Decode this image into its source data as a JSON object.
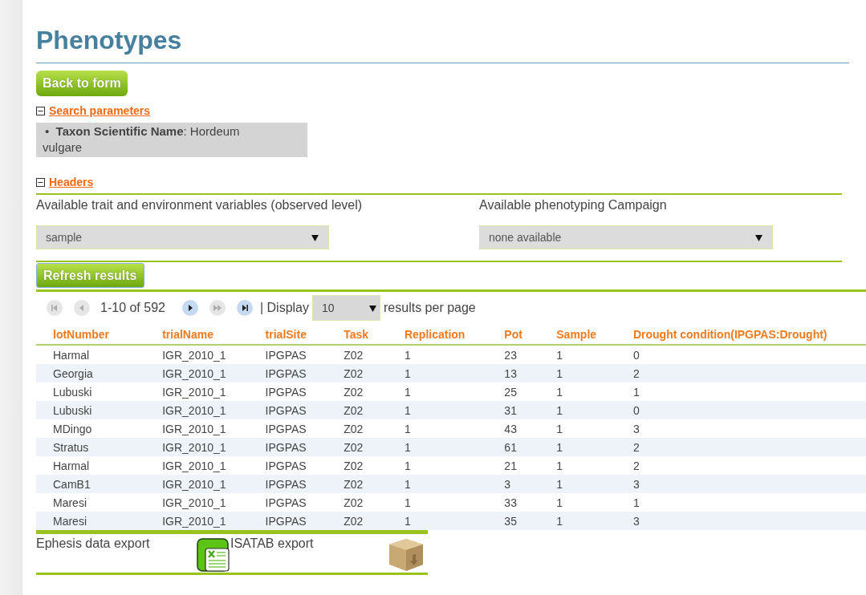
{
  "title": "Phenotypes",
  "back_button": "Back to form",
  "search_parameters": {
    "label": "Search parameters",
    "expanded": true,
    "items": [
      "•  **Taxon Scientific Name**: Hordeum vulgare"
    ]
  },
  "headers": {
    "label": "Headers",
    "expanded": true,
    "selects": [
      {
        "label": "Available trait and environment variables (observed level)",
        "value": "sample"
      },
      {
        "label": "Available phenotyping Campaign",
        "value": "none available"
      }
    ]
  },
  "refresh_button": "Refresh results",
  "pager": {
    "buttons": [
      {
        "kind": "first",
        "disabled": true
      },
      {
        "kind": "prev",
        "disabled": true
      },
      {
        "kind": "range",
        "text": "1-10 of 592"
      },
      {
        "kind": "next",
        "disabled": false
      },
      {
        "kind": "fast",
        "disabled": true
      },
      {
        "kind": "last",
        "disabled": false
      }
    ],
    "display_label": "| Display",
    "page_size": "10",
    "suffix": "results per page"
  },
  "table": {
    "columns": [
      "lotNumber",
      "trialName",
      "trialSite",
      "Task",
      "Replication",
      "Pot",
      "Sample",
      "Drought condition(IPGPAS:Drought)"
    ],
    "rows": [
      [
        "Harmal",
        "IGR_2010_1",
        "IPGPAS",
        "Z02",
        "1",
        "23",
        "1",
        "0"
      ],
      [
        "Georgia",
        "IGR_2010_1",
        "IPGPAS",
        "Z02",
        "1",
        "13",
        "1",
        "2"
      ],
      [
        "Lubuski",
        "IGR_2010_1",
        "IPGPAS",
        "Z02",
        "1",
        "25",
        "1",
        "1"
      ],
      [
        "Lubuski",
        "IGR_2010_1",
        "IPGPAS",
        "Z02",
        "1",
        "31",
        "1",
        "0"
      ],
      [
        "MDingo",
        "IGR_2010_1",
        "IPGPAS",
        "Z02",
        "1",
        "43",
        "1",
        "3"
      ],
      [
        "Stratus",
        "IGR_2010_1",
        "IPGPAS",
        "Z02",
        "1",
        "61",
        "1",
        "2"
      ],
      [
        "Harmal",
        "IGR_2010_1",
        "IPGPAS",
        "Z02",
        "1",
        "21",
        "1",
        "2"
      ],
      [
        "CamB1",
        "IGR_2010_1",
        "IPGPAS",
        "Z02",
        "1",
        "3",
        "1",
        "3"
      ],
      [
        "Maresi",
        "IGR_2010_1",
        "IPGPAS",
        "Z02",
        "1",
        "33",
        "1",
        "1"
      ],
      [
        "Maresi",
        "IGR_2010_1",
        "IPGPAS",
        "Z02",
        "1",
        "35",
        "1",
        "3"
      ]
    ]
  },
  "exports": [
    {
      "label": "Ephesis data export",
      "kind": "spreadsheet"
    },
    {
      "label": "ISATAB export",
      "kind": "package"
    }
  ]
}
